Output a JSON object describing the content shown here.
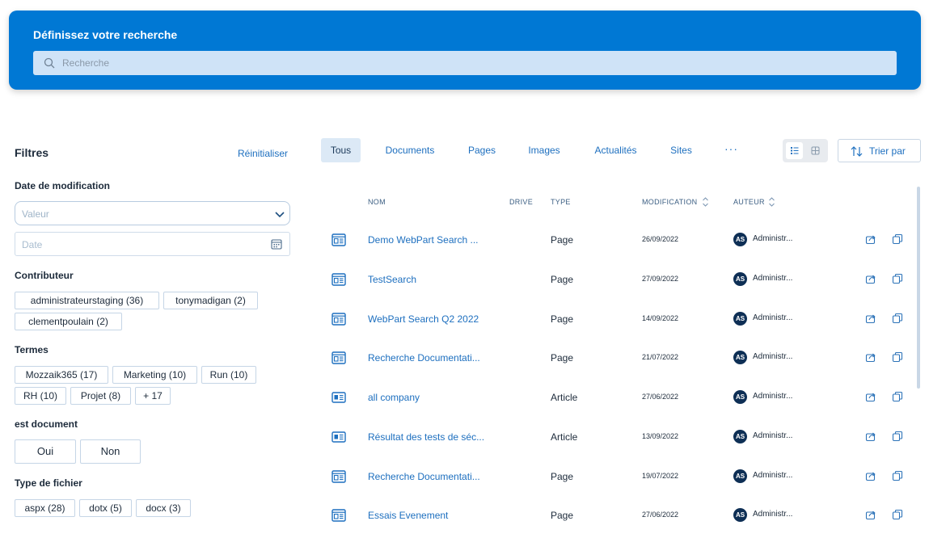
{
  "search": {
    "title": "Définissez votre recherche",
    "placeholder": "Recherche",
    "value": ""
  },
  "filters": {
    "title": "Filtres",
    "reset_label": "Réinitialiser",
    "date": {
      "title": "Date de modification",
      "select_placeholder": "Valeur",
      "date_placeholder": "Date"
    },
    "contributor": {
      "title": "Contributeur",
      "chips": [
        "administrateurstaging (36)",
        "tonymadigan (2)",
        "clementpoulain (2)"
      ]
    },
    "terms": {
      "title": "Termes",
      "chips": [
        "Mozzaik365 (17)",
        "Marketing (10)",
        "Run (10)",
        "RH (10)",
        "Projet (8)",
        "+ 17"
      ]
    },
    "is_document": {
      "title": "est document",
      "options": [
        "Oui",
        "Non"
      ]
    },
    "file_type": {
      "title": "Type de fichier",
      "chips": [
        "aspx (28)",
        "dotx (5)",
        "docx (3)"
      ]
    }
  },
  "tabs": [
    "Tous",
    "Documents",
    "Pages",
    "Images",
    "Actualités",
    "Sites"
  ],
  "active_tab": "Tous",
  "more_label": "···",
  "sort_label": "Trier par",
  "columns": {
    "name": "NOM",
    "drive": "DRIVE",
    "type": "TYPE",
    "modification": "MODIFICATION",
    "author": "AUTEUR"
  },
  "rows": [
    {
      "icon": "page-icon",
      "name": "Demo WebPart Search ...",
      "type": "Page",
      "date": "26/09/2022",
      "initials": "AS",
      "author": "Administr..."
    },
    {
      "icon": "page-icon",
      "name": "TestSearch",
      "type": "Page",
      "date": "27/09/2022",
      "initials": "AS",
      "author": "Administr..."
    },
    {
      "icon": "page-icon",
      "name": "WebPart Search Q2 2022",
      "type": "Page",
      "date": "14/09/2022",
      "initials": "AS",
      "author": "Administr..."
    },
    {
      "icon": "page-icon",
      "name": "Recherche Documentati...",
      "type": "Page",
      "date": "21/07/2022",
      "initials": "AS",
      "author": "Administr..."
    },
    {
      "icon": "article-icon",
      "name": "all company",
      "type": "Article",
      "date": "27/06/2022",
      "initials": "AS",
      "author": "Administr..."
    },
    {
      "icon": "article-icon",
      "name": "Résultat des tests de séc...",
      "type": "Article",
      "date": "13/09/2022",
      "initials": "AS",
      "author": "Administr..."
    },
    {
      "icon": "page-icon",
      "name": "Recherche Documentati...",
      "type": "Page",
      "date": "19/07/2022",
      "initials": "AS",
      "author": "Administr..."
    },
    {
      "icon": "page-icon",
      "name": "Essais Evenement",
      "type": "Page",
      "date": "27/06/2022",
      "initials": "AS",
      "author": "Administr..."
    }
  ],
  "colors": {
    "accent": "#0078d4",
    "link": "#1d6fbf",
    "avatar": "#0e2f55"
  }
}
